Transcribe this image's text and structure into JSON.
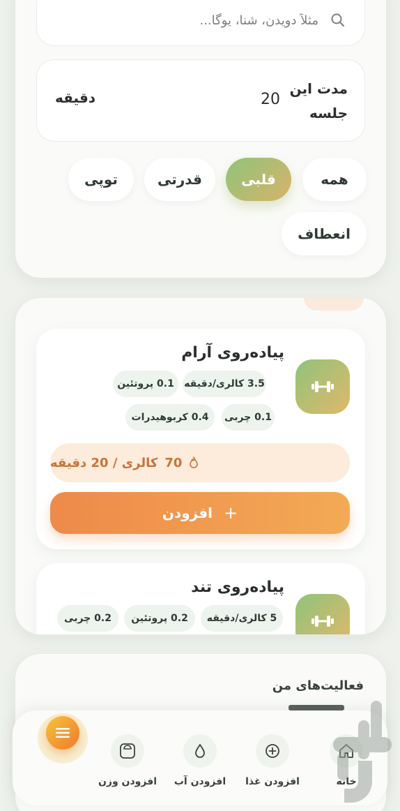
{
  "search": {
    "placeholder": "مثلاً دویدن، شنا، یوگا..."
  },
  "duration": {
    "label": "مدت این جلسه",
    "value": "20",
    "unit": "دقیقه"
  },
  "filters": [
    {
      "label": "همه",
      "active": false
    },
    {
      "label": "قلبی",
      "active": true
    },
    {
      "label": "قدرتی",
      "active": false
    },
    {
      "label": "توپی",
      "active": false
    },
    {
      "label": "انعطاف",
      "active": false
    }
  ],
  "activities": [
    {
      "title": "پیاده‌روی آرام",
      "icon": "dumbbell-icon",
      "stats": [
        "3.5 کالری/دقیقه",
        "0.1 پروتئین",
        "0.1 چربی",
        "0.4 کربوهیدرات"
      ],
      "calories_number": "70",
      "calories_text": "کالری / 20 دقیقه",
      "add_label": "افزودن"
    },
    {
      "title": "پیاده‌روی تند",
      "icon": "dumbbell-icon",
      "stats": [
        "5 کالری/دقیقه",
        "0.2 پروتئین",
        "0.2 چربی"
      ]
    }
  ],
  "my_activities": {
    "title": "فعالیت‌های من"
  },
  "nav": [
    {
      "label": "خانه",
      "icon": "home-icon"
    },
    {
      "label": "افزودن غذا",
      "icon": "plus-circle-icon"
    },
    {
      "label": "افزودن آب",
      "icon": "water-drop-icon"
    },
    {
      "label": "افزودن وزن",
      "icon": "scale-icon"
    }
  ],
  "fab": {
    "icon": "menu-icon"
  },
  "colors": {
    "accent_green": "#8fc47a",
    "accent_orange": "#ee8a4a",
    "calorie_text": "#c7743a"
  }
}
